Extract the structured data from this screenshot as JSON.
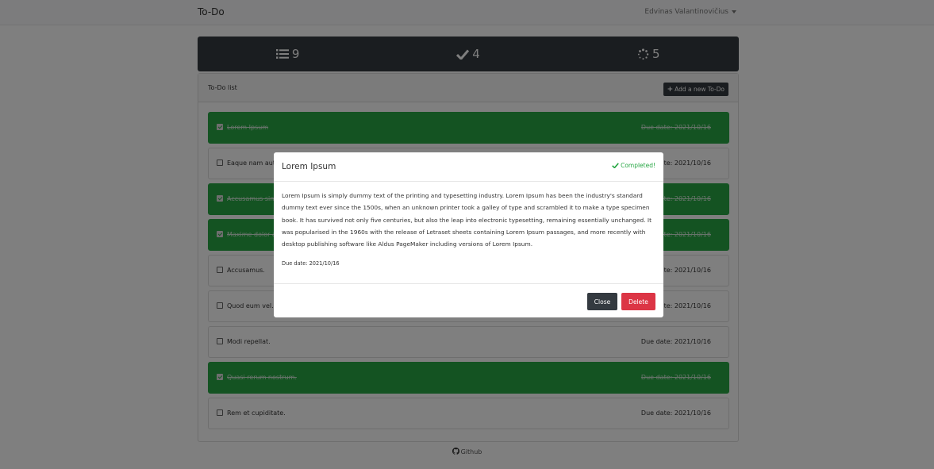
{
  "navbar": {
    "brand": "To-Do",
    "user_name": "Edvinas Valantinovičius"
  },
  "stats": {
    "total": "9",
    "completed": "4",
    "pending": "5",
    "total_icon": "list-icon",
    "completed_icon": "check-icon",
    "pending_icon": "spinner-icon"
  },
  "panel": {
    "title": "To-Do list",
    "add_button": "Add a new To-Do"
  },
  "todos": [
    {
      "title": "Lorem Ipsum",
      "due": "Due date: 2021/10/16",
      "done": true
    },
    {
      "title": "Eaque nam aut",
      "due": "Due date: 2021/10/16",
      "done": false
    },
    {
      "title": "Accusamus sim",
      "due": "Due date: 2021/10/16",
      "done": true
    },
    {
      "title": "Maxime dolor a",
      "due": "Due date: 2021/10/16",
      "done": true
    },
    {
      "title": "Accusamus.",
      "due": "Due date: 2021/10/16",
      "done": false
    },
    {
      "title": "Quod eum vel.",
      "due": "Due date: 2021/10/16",
      "done": false
    },
    {
      "title": "Modi repellat.",
      "due": "Due date: 2021/10/16",
      "done": false
    },
    {
      "title": "Quasi rerum nostrum.",
      "due": "Due date: 2021/10/16",
      "done": true
    },
    {
      "title": "Rem et cupiditate.",
      "due": "Due date: 2021/10/16",
      "done": false
    }
  ],
  "footer": {
    "link": "Github"
  },
  "modal": {
    "title": "Lorem Ipsum",
    "status": "Completed!",
    "description": "Lorem Ipsum is simply dummy text of the printing and typesetting industry. Lorem Ipsum has been the industry's standard dummy text ever since the 1500s, when an unknown printer took a galley of type and scrambled it to make a type specimen book. It has survived not only five centuries, but also the leap into electronic typesetting, remaining essentially unchanged. It was popularised in the 1960s with the release of Letraset sheets containing Lorem Ipsum passages, and more recently with desktop publishing software like Aldus PageMaker including versions of Lorem Ipsum.",
    "due": "Due date: 2021/10/16",
    "close_button": "Close",
    "delete_button": "Delete"
  },
  "colors": {
    "done": "#28a745",
    "dark": "#343a40",
    "danger": "#dc3545"
  }
}
